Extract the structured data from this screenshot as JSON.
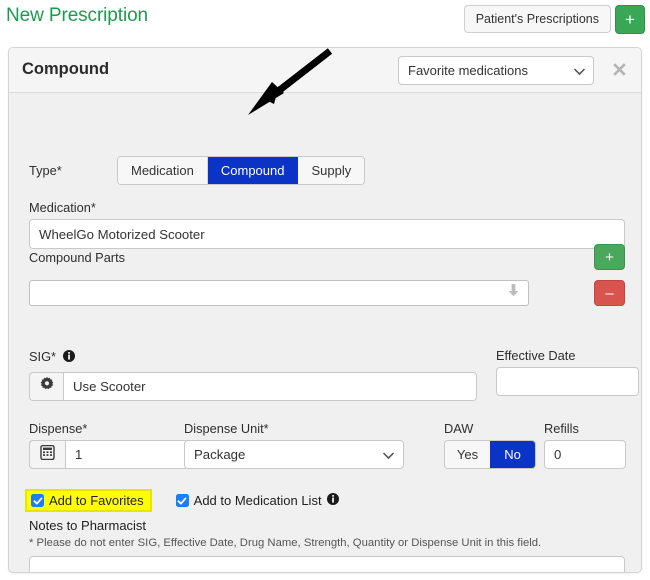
{
  "topbar": {
    "title": "New Prescription",
    "patient_prescriptions_label": "Patient's Prescriptions",
    "add_button_label": "+"
  },
  "card": {
    "title": "Compound",
    "favorite_select_value": "Favorite medications",
    "close_label": "✖"
  },
  "form": {
    "type": {
      "label": "Type*",
      "options": [
        "Medication",
        "Compound",
        "Supply"
      ],
      "selected": "Compound"
    },
    "medication": {
      "label": "Medication*",
      "value": "WheelGo Motorized Scooter"
    },
    "compound_parts": {
      "label": "Compound Parts",
      "value": "",
      "add_label": "+",
      "remove_label": "–"
    },
    "sig": {
      "label": "SIG*",
      "value": "Use Scooter",
      "gear_label": ""
    },
    "effective_date": {
      "label": "Effective Date",
      "value": ""
    },
    "dispense": {
      "label": "Dispense*",
      "value": "1"
    },
    "dispense_unit": {
      "label": "Dispense Unit*",
      "value": "Package"
    },
    "daw": {
      "label": "DAW",
      "options": [
        "Yes",
        "No"
      ],
      "selected": "No"
    },
    "refills": {
      "label": "Refills",
      "value": "0"
    },
    "add_to_favorites": {
      "label": "Add to Favorites",
      "checked": true
    },
    "add_to_medication_list": {
      "label": "Add to Medication List",
      "checked": true
    },
    "notes": {
      "label": "Notes to Pharmacist",
      "hint": "* Please do not enter SIG, Effective Date, Drug Name, Strength, Quantity or Dispense Unit in this field.",
      "value": ""
    }
  },
  "colors": {
    "title_green": "#1a9b4e",
    "accent_blue": "#0b33c6",
    "add_green": "#3aa757",
    "remove_red": "#d9534f",
    "checkbox_blue": "#1b7ef7",
    "highlight_yellow": "#ffff00"
  }
}
